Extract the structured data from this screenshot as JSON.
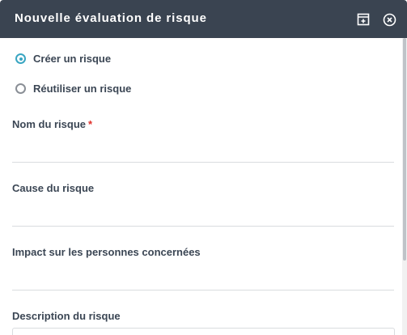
{
  "dialog": {
    "title": "Nouvelle évaluation de risque",
    "header_color": "#3a4451",
    "icons": {
      "maximize": "expand-window-icon",
      "close": "close-circle-icon"
    }
  },
  "risk_mode": {
    "options": [
      {
        "label": "Créer un risque",
        "checked": true
      },
      {
        "label": "Réutiliser un risque",
        "checked": false
      }
    ],
    "accent_color": "#3aa6c2"
  },
  "fields": {
    "name": {
      "label": "Nom du risque",
      "required_marker": "*",
      "value": ""
    },
    "cause": {
      "label": "Cause du risque",
      "value": ""
    },
    "impact": {
      "label": "Impact sur les personnes concernées",
      "value": ""
    },
    "description": {
      "label": "Description du risque",
      "value": ""
    }
  }
}
